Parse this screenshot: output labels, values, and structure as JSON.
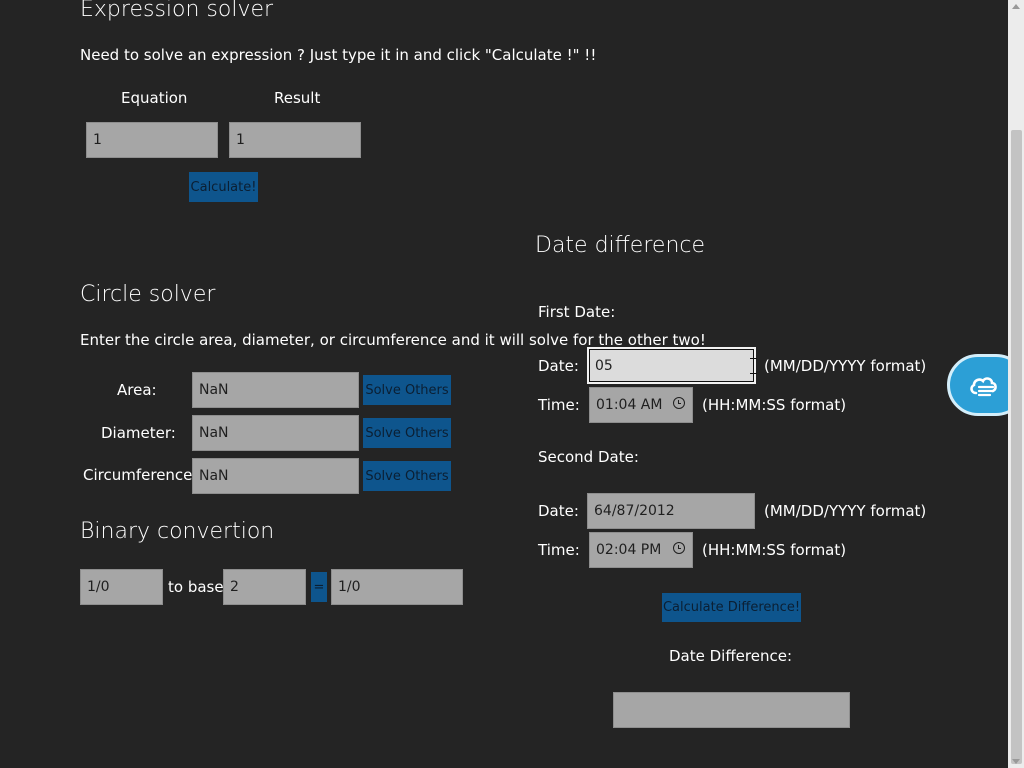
{
  "expression_solver": {
    "title": "Expression solver",
    "description": "Need to solve an expression ? Just type it in and click \"Calculate !\" !!",
    "equation_label": "Equation",
    "result_label": "Result",
    "equation_value": "1",
    "result_value": "1",
    "calculate_label": "Calculate!"
  },
  "circle_solver": {
    "title": "Circle solver",
    "description": "Enter the circle area, diameter, or circumference and it will solve for the other two!",
    "rows": [
      {
        "label": "Area:",
        "value": "NaN",
        "button": "Solve Others"
      },
      {
        "label": "Diameter:",
        "value": "NaN",
        "button": "Solve Others"
      },
      {
        "label": "Circumference:",
        "value": "NaN",
        "button": "Solve Others"
      }
    ]
  },
  "binary_conversion": {
    "title": "Binary convertion",
    "input_value": "1/0",
    "to_base_label": "to base",
    "base_value": "2",
    "equals_label": "=",
    "output_value": "1/0"
  },
  "date_difference": {
    "title": "Date difference",
    "first_date_label": "First Date:",
    "second_date_label": "Second Date:",
    "date_label": "Date:",
    "time_label": "Time:",
    "date_format_hint": "(MM/DD/YYYY format)",
    "time_format_hint": "(HH:MM:SS format)",
    "first_date_value": "05",
    "first_time_value": "01:04 AM",
    "second_date_value": "64/87/2012",
    "second_time_value": "02:04 PM",
    "calculate_label": "Calculate Difference!",
    "result_label": "Date Difference:",
    "result_value": ""
  },
  "icons": {
    "floating_button": "cloud-share-icon",
    "scroll_up": "scroll-up-arrow-icon",
    "scroll_down": "scroll-down-arrow-icon",
    "clock": "clock-icon",
    "cursor": "text-cursor-icon"
  },
  "colors": {
    "background": "#242424",
    "field": "#a6a6a6",
    "button": "#0e558d",
    "floating_button": "#2c9fd6"
  }
}
